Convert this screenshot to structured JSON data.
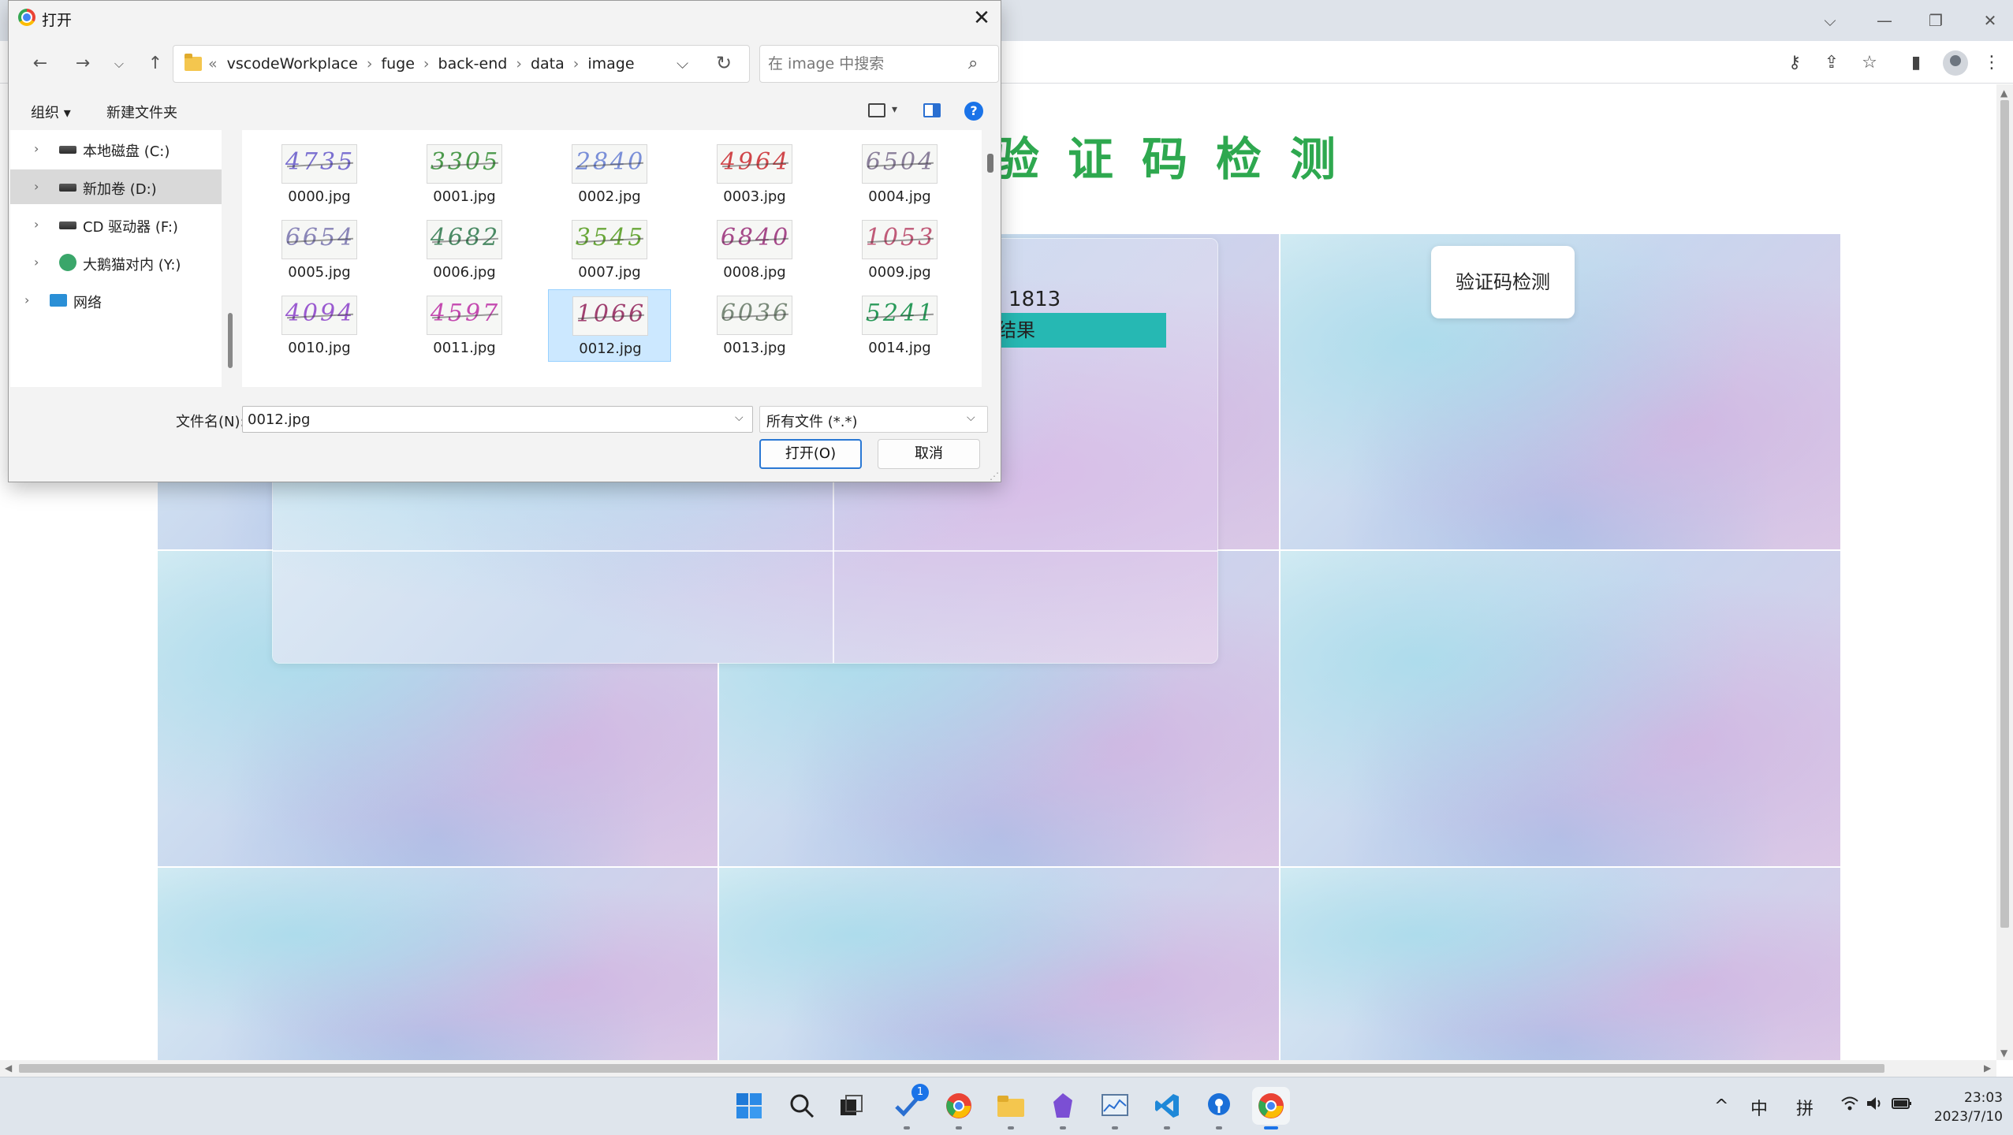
{
  "browser": {
    "window_controls": {
      "chevron": "⌵",
      "minimize": "—",
      "restore": "❐",
      "close": "✕"
    },
    "toolbar_icons": [
      "key-icon",
      "share-icon",
      "star-icon",
      "sidepanel-icon",
      "profile-icon",
      "menu-icon"
    ]
  },
  "page": {
    "heading": "验证码检测",
    "count_text": ": 1813",
    "result_label": "结果",
    "detect_button": "验证码检测"
  },
  "dialog": {
    "title": "打开",
    "close": "✕",
    "address": {
      "more": "«",
      "crumbs": [
        "vscodeWorkplace",
        "fuge",
        "back-end",
        "data",
        "image"
      ]
    },
    "search_placeholder": "在 image 中搜索",
    "commands": {
      "organize": "组织 ▾",
      "new_folder": "新建文件夹",
      "help": "?"
    },
    "tree": [
      {
        "label": "本地磁盘 (C:)",
        "icon": "drive-icon",
        "selected": false
      },
      {
        "label": "新加卷 (D:)",
        "icon": "drive-icon",
        "selected": true
      },
      {
        "label": "CD 驱动器 (F:)",
        "icon": "cd-drive-icon",
        "selected": false
      },
      {
        "label": "大鹅猫对内 (Y:)",
        "icon": "network-drive-icon",
        "selected": false
      },
      {
        "label": "网络",
        "icon": "network-icon",
        "selected": false
      }
    ],
    "files": [
      {
        "name": "0000.jpg",
        "glyphs": "4735",
        "color": "#7a6fd0"
      },
      {
        "name": "0001.jpg",
        "glyphs": "3305",
        "color": "#4c9a4c"
      },
      {
        "name": "0002.jpg",
        "glyphs": "2840",
        "color": "#7a8fd8"
      },
      {
        "name": "0003.jpg",
        "glyphs": "4964",
        "color": "#d0464a"
      },
      {
        "name": "0004.jpg",
        "glyphs": "6504",
        "color": "#8a7f9a"
      },
      {
        "name": "0005.jpg",
        "glyphs": "6654",
        "color": "#8a86b8"
      },
      {
        "name": "0006.jpg",
        "glyphs": "4682",
        "color": "#4a8a64"
      },
      {
        "name": "0007.jpg",
        "glyphs": "3545",
        "color": "#6aa83a"
      },
      {
        "name": "0008.jpg",
        "glyphs": "6840",
        "color": "#a64a8a"
      },
      {
        "name": "0009.jpg",
        "glyphs": "1053",
        "color": "#c05a78"
      },
      {
        "name": "0010.jpg",
        "glyphs": "4094",
        "color": "#9a5ad0"
      },
      {
        "name": "0011.jpg",
        "glyphs": "4597",
        "color": "#c44ab0"
      },
      {
        "name": "0012.jpg",
        "glyphs": "1066",
        "color": "#a04070"
      },
      {
        "name": "0013.jpg",
        "glyphs": "6036",
        "color": "#7a8a7a"
      },
      {
        "name": "0014.jpg",
        "glyphs": "5241",
        "color": "#2a9a5a"
      }
    ],
    "selected_file": "0012.jpg",
    "filename_label": "文件名(N):",
    "filename_value": "0012.jpg",
    "filter_value": "所有文件 (*.*)",
    "open_button": "打开(O)",
    "cancel_button": "取消"
  },
  "taskbar": {
    "badge_count": "1",
    "tray": {
      "chevron": "^",
      "ime_lang": "中",
      "ime_mode": "拼"
    },
    "clock_time": "23:03",
    "clock_date": "2023/7/10"
  }
}
